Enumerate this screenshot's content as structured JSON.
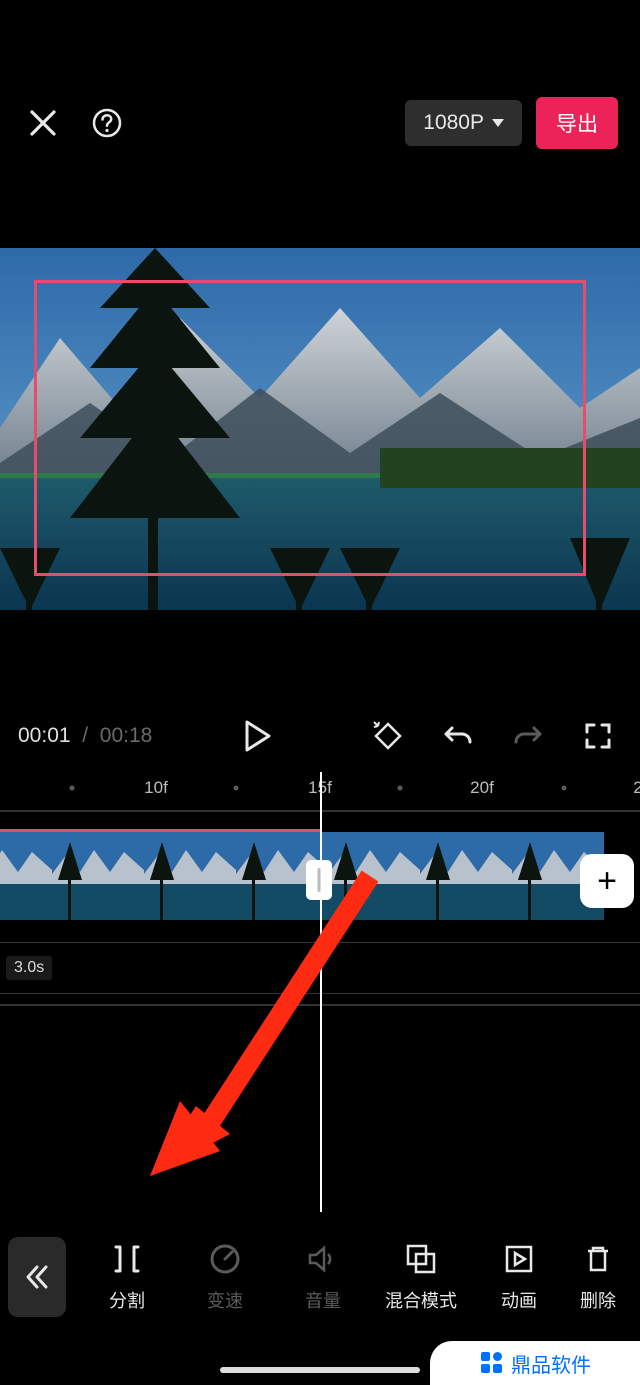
{
  "header": {
    "resolution_label": "1080P",
    "export_label": "导出"
  },
  "playback": {
    "current_time": "00:01",
    "separator": "/",
    "total_time": "00:18"
  },
  "timeline": {
    "marks": [
      "10f",
      "15f",
      "20f"
    ],
    "badge": "3.0s"
  },
  "toolbar": {
    "items": [
      {
        "key": "split",
        "label": "分割",
        "fade": false
      },
      {
        "key": "speed",
        "label": "变速",
        "fade": true
      },
      {
        "key": "volume",
        "label": "音量",
        "fade": true
      },
      {
        "key": "blend",
        "label": "混合模式",
        "fade": false
      },
      {
        "key": "anim",
        "label": "动画",
        "fade": false
      },
      {
        "key": "delete",
        "label": "删除",
        "fade": false
      }
    ]
  },
  "watermark": {
    "text": "鼎品软件"
  }
}
